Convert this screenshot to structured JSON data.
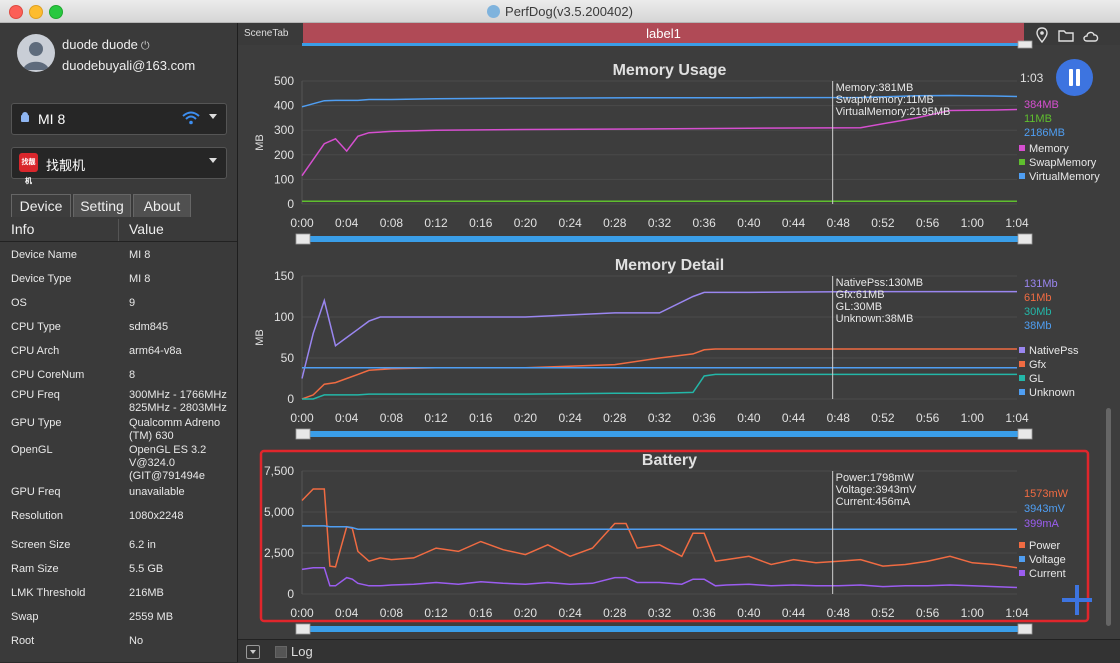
{
  "window": {
    "title": "PerfDog(v3.5.200402)"
  },
  "user": {
    "name": "duode duode",
    "email": "duodebuyali@163.com"
  },
  "device_select": {
    "label": "MI 8"
  },
  "app_select": {
    "label": "找靓机",
    "icon_text": "找靓机"
  },
  "tabs": [
    {
      "label": "Device"
    },
    {
      "label": "Setting"
    },
    {
      "label": "About"
    }
  ],
  "info_table": {
    "headers": [
      "Info",
      "Value"
    ],
    "rows": [
      {
        "key": "Device Name",
        "value": "MI 8"
      },
      {
        "key": "Device Type",
        "value": "MI 8"
      },
      {
        "key": "OS",
        "value": "9"
      },
      {
        "key": "CPU Type",
        "value": "sdm845"
      },
      {
        "key": "CPU Arch",
        "value": "arm64-v8a"
      },
      {
        "key": "CPU CoreNum",
        "value": "8"
      },
      {
        "key": "CPU Freq",
        "value": "300MHz - 1766MHz 825MHz - 2803MHz"
      },
      {
        "key": "GPU Type",
        "value": "Qualcomm Adreno (TM) 630"
      },
      {
        "key": "OpenGL",
        "value": "OpenGL ES 3.2 V@324.0 (GIT@791494e"
      },
      {
        "key": "GPU Freq",
        "value": "unavailable"
      },
      {
        "key": "Resolution",
        "value": "1080x2248"
      },
      {
        "key": "Screen Size",
        "value": "6.2 in"
      },
      {
        "key": "Ram Size",
        "value": "5.5 GB"
      },
      {
        "key": "LMK Threshold",
        "value": "216MB"
      },
      {
        "key": "Swap",
        "value": "2559 MB"
      },
      {
        "key": "Root",
        "value": "No"
      }
    ]
  },
  "scene": {
    "tab_label": "SceneTab",
    "label": "label1"
  },
  "controls": {
    "elapsed": "1:03"
  },
  "log": {
    "label": "Log"
  },
  "colors": {
    "memory": "#d64fd0",
    "swap": "#5fbf2e",
    "virtual": "#4f9ef2",
    "nativepss": "#9a86f0",
    "gfx": "#f06b42",
    "gl": "#23b7a8",
    "unknown": "#4f9ef2",
    "power": "#f06b42",
    "voltage": "#4f9ef2",
    "current": "#9b5df0",
    "highlight": "#e0262c"
  },
  "chart_data": [
    {
      "type": "line",
      "title": "Memory Usage",
      "ylabel": "MB",
      "ylim": [
        0,
        500
      ],
      "yticks": [
        "500",
        "400",
        "300",
        "200",
        "100",
        "0"
      ],
      "x_ticks": [
        "0:00",
        "0:04",
        "0:08",
        "0:12",
        "0:16",
        "0:20",
        "0:24",
        "0:28",
        "0:32",
        "0:36",
        "0:40",
        "0:44",
        "0:48",
        "0:52",
        "0:56",
        "1:00",
        "1:04"
      ],
      "x_seconds": [
        0,
        2,
        3,
        4,
        5,
        6,
        8,
        12,
        20,
        30,
        40,
        50,
        55,
        58,
        60,
        62,
        64
      ],
      "series": [
        {
          "name": "Memory",
          "values": [
            115,
            245,
            265,
            215,
            275,
            290,
            295,
            300,
            303,
            305,
            308,
            310,
            350,
            380,
            381,
            382,
            384
          ]
        },
        {
          "name": "SwapMemory",
          "values": [
            11,
            11,
            11,
            11,
            11,
            11,
            11,
            11,
            11,
            11,
            11,
            11,
            11,
            11,
            11,
            11,
            11
          ]
        },
        {
          "name": "VirtualMemory",
          "values": [
            395,
            420,
            421,
            421,
            421,
            425,
            425,
            428,
            430,
            432,
            432,
            433,
            440,
            441,
            440,
            439,
            437
          ]
        }
      ],
      "cursor_x": 47.5,
      "annotation": [
        "Memory:381MB",
        "SwapMemory:11MB",
        "VirtualMemory:2195MB"
      ],
      "current_values": [
        "384MB",
        "11MB",
        "2186MB"
      ],
      "legend": [
        "Memory",
        "SwapMemory",
        "VirtualMemory"
      ]
    },
    {
      "type": "line",
      "title": "Memory Detail",
      "ylabel": "MB",
      "ylim": [
        0,
        150
      ],
      "yticks": [
        "150",
        "100",
        "50",
        "0"
      ],
      "x_ticks": [
        "0:00",
        "0:04",
        "0:08",
        "0:12",
        "0:16",
        "0:20",
        "0:24",
        "0:28",
        "0:32",
        "0:36",
        "0:40",
        "0:44",
        "0:48",
        "0:52",
        "0:56",
        "1:00",
        "1:04"
      ],
      "x_seconds": [
        0,
        1,
        2,
        3,
        4,
        5,
        6,
        7,
        8,
        12,
        20,
        28,
        32,
        35,
        36,
        37,
        40,
        50,
        64
      ],
      "series": [
        {
          "name": "NativePss",
          "values": [
            25,
            80,
            120,
            65,
            75,
            85,
            95,
            100,
            100,
            100,
            100,
            105,
            105,
            125,
            130,
            130,
            130,
            131,
            131
          ]
        },
        {
          "name": "Gfx",
          "values": [
            0,
            5,
            18,
            20,
            25,
            30,
            35,
            36,
            37,
            38,
            38,
            42,
            50,
            55,
            60,
            61,
            61,
            61,
            61
          ]
        },
        {
          "name": "GL",
          "values": [
            0,
            0,
            5,
            5,
            5,
            5,
            6,
            6,
            6,
            6,
            6,
            7,
            7,
            8,
            28,
            30,
            30,
            30,
            30
          ]
        },
        {
          "name": "Unknown",
          "values": [
            38,
            38,
            38,
            38,
            38,
            38,
            38,
            38,
            38,
            38,
            38,
            38,
            38,
            38,
            38,
            38,
            38,
            38,
            38
          ]
        }
      ],
      "cursor_x": 47.5,
      "annotation": [
        "NativePss:130MB",
        "Gfx:61MB",
        "GL:30MB",
        "Unknown:38MB"
      ],
      "current_values": [
        "131Mb",
        "61Mb",
        "30Mb",
        "38Mb"
      ],
      "legend": [
        "NativePss",
        "Gfx",
        "GL",
        "Unknown"
      ]
    },
    {
      "type": "line",
      "title": "Battery",
      "ylabel": "",
      "ylim": [
        0,
        7500
      ],
      "yticks": [
        "7,500",
        "5,000",
        "2,500",
        "0"
      ],
      "x_ticks": [
        "0:00",
        "0:04",
        "0:08",
        "0:12",
        "0:16",
        "0:20",
        "0:24",
        "0:28",
        "0:32",
        "0:36",
        "0:40",
        "0:44",
        "0:48",
        "0:52",
        "0:56",
        "1:00",
        "1:04"
      ],
      "x_seconds": [
        0,
        1,
        2,
        2.5,
        3,
        4,
        4.5,
        5,
        6,
        7,
        8,
        10,
        12,
        14,
        16,
        18,
        20,
        22,
        24,
        26,
        28,
        29,
        30,
        32,
        34,
        35,
        36,
        37,
        38,
        40,
        42,
        44,
        46,
        48,
        50,
        52,
        54,
        56,
        58,
        60,
        62,
        64
      ],
      "series": [
        {
          "name": "Power",
          "values": [
            5700,
            6400,
            6400,
            1700,
            1650,
            4100,
            4000,
            2600,
            2000,
            2200,
            2100,
            2200,
            2800,
            2600,
            3200,
            2700,
            2400,
            3000,
            2300,
            2800,
            4300,
            4300,
            2800,
            3000,
            2300,
            3700,
            3700,
            2000,
            2100,
            2300,
            1800,
            2100,
            1900,
            2000,
            2100,
            1700,
            1800,
            2000,
            2300,
            1900,
            1800,
            1600
          ]
        },
        {
          "name": "Voltage",
          "values": [
            4150,
            4150,
            4150,
            4100,
            4100,
            4100,
            4050,
            3950,
            3950,
            3950,
            3950,
            3950,
            3950,
            3950,
            3950,
            3950,
            3950,
            3950,
            3950,
            3950,
            3950,
            3950,
            3950,
            3950,
            3950,
            3950,
            3950,
            3950,
            3950,
            3950,
            3950,
            3950,
            3950,
            3950,
            3950,
            3950,
            3950,
            3950,
            3950,
            3950,
            3950,
            3943
          ]
        },
        {
          "name": "Current",
          "values": [
            1500,
            1600,
            1600,
            500,
            500,
            1000,
            900,
            650,
            500,
            500,
            550,
            600,
            700,
            600,
            750,
            650,
            600,
            700,
            600,
            650,
            1000,
            1000,
            700,
            700,
            600,
            900,
            900,
            500,
            550,
            600,
            500,
            550,
            500,
            500,
            550,
            450,
            500,
            500,
            550,
            500,
            450,
            399
          ]
        }
      ],
      "cursor_x": 47.5,
      "annotation": [
        "Power:1798mW",
        "Voltage:3943mV",
        "Current:456mA"
      ],
      "current_values": [
        "1573mW",
        "3943mV",
        "399mA"
      ],
      "legend": [
        "Power",
        "Voltage",
        "Current"
      ]
    }
  ]
}
